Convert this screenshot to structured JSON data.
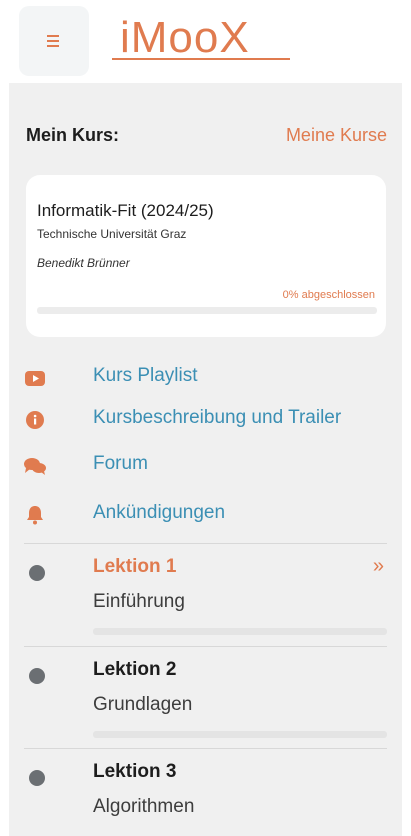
{
  "header": {
    "logo_text": "iMooX",
    "brand_color": "#e07b4f"
  },
  "course": {
    "heading": "Mein Kurs:",
    "my_courses_link": "Meine Kurse",
    "title": "Informatik-Fit (2024/25)",
    "university": "Technische Universität Graz",
    "author": "Benedikt Brünner",
    "progress_label": "0% abgeschlossen",
    "progress_percent": 0
  },
  "nav": [
    {
      "icon": "youtube-icon",
      "label": "Kurs Playlist"
    },
    {
      "icon": "info-icon",
      "label": "Kursbeschreibung und Trailer"
    },
    {
      "icon": "comments-icon",
      "label": "Forum"
    },
    {
      "icon": "bell-icon",
      "label": "Ankündigungen"
    }
  ],
  "lessons": [
    {
      "title": "Lektion 1",
      "subtitle": "Einführung",
      "active": true,
      "chevron": "»"
    },
    {
      "title": "Lektion 2",
      "subtitle": "Grundlagen",
      "active": false
    },
    {
      "title": "Lektion 3",
      "subtitle": "Algorithmen",
      "active": false
    }
  ],
  "colors": {
    "accent": "#e07b4f",
    "link": "#3b8fb4",
    "panel": "#f0f0f0"
  }
}
